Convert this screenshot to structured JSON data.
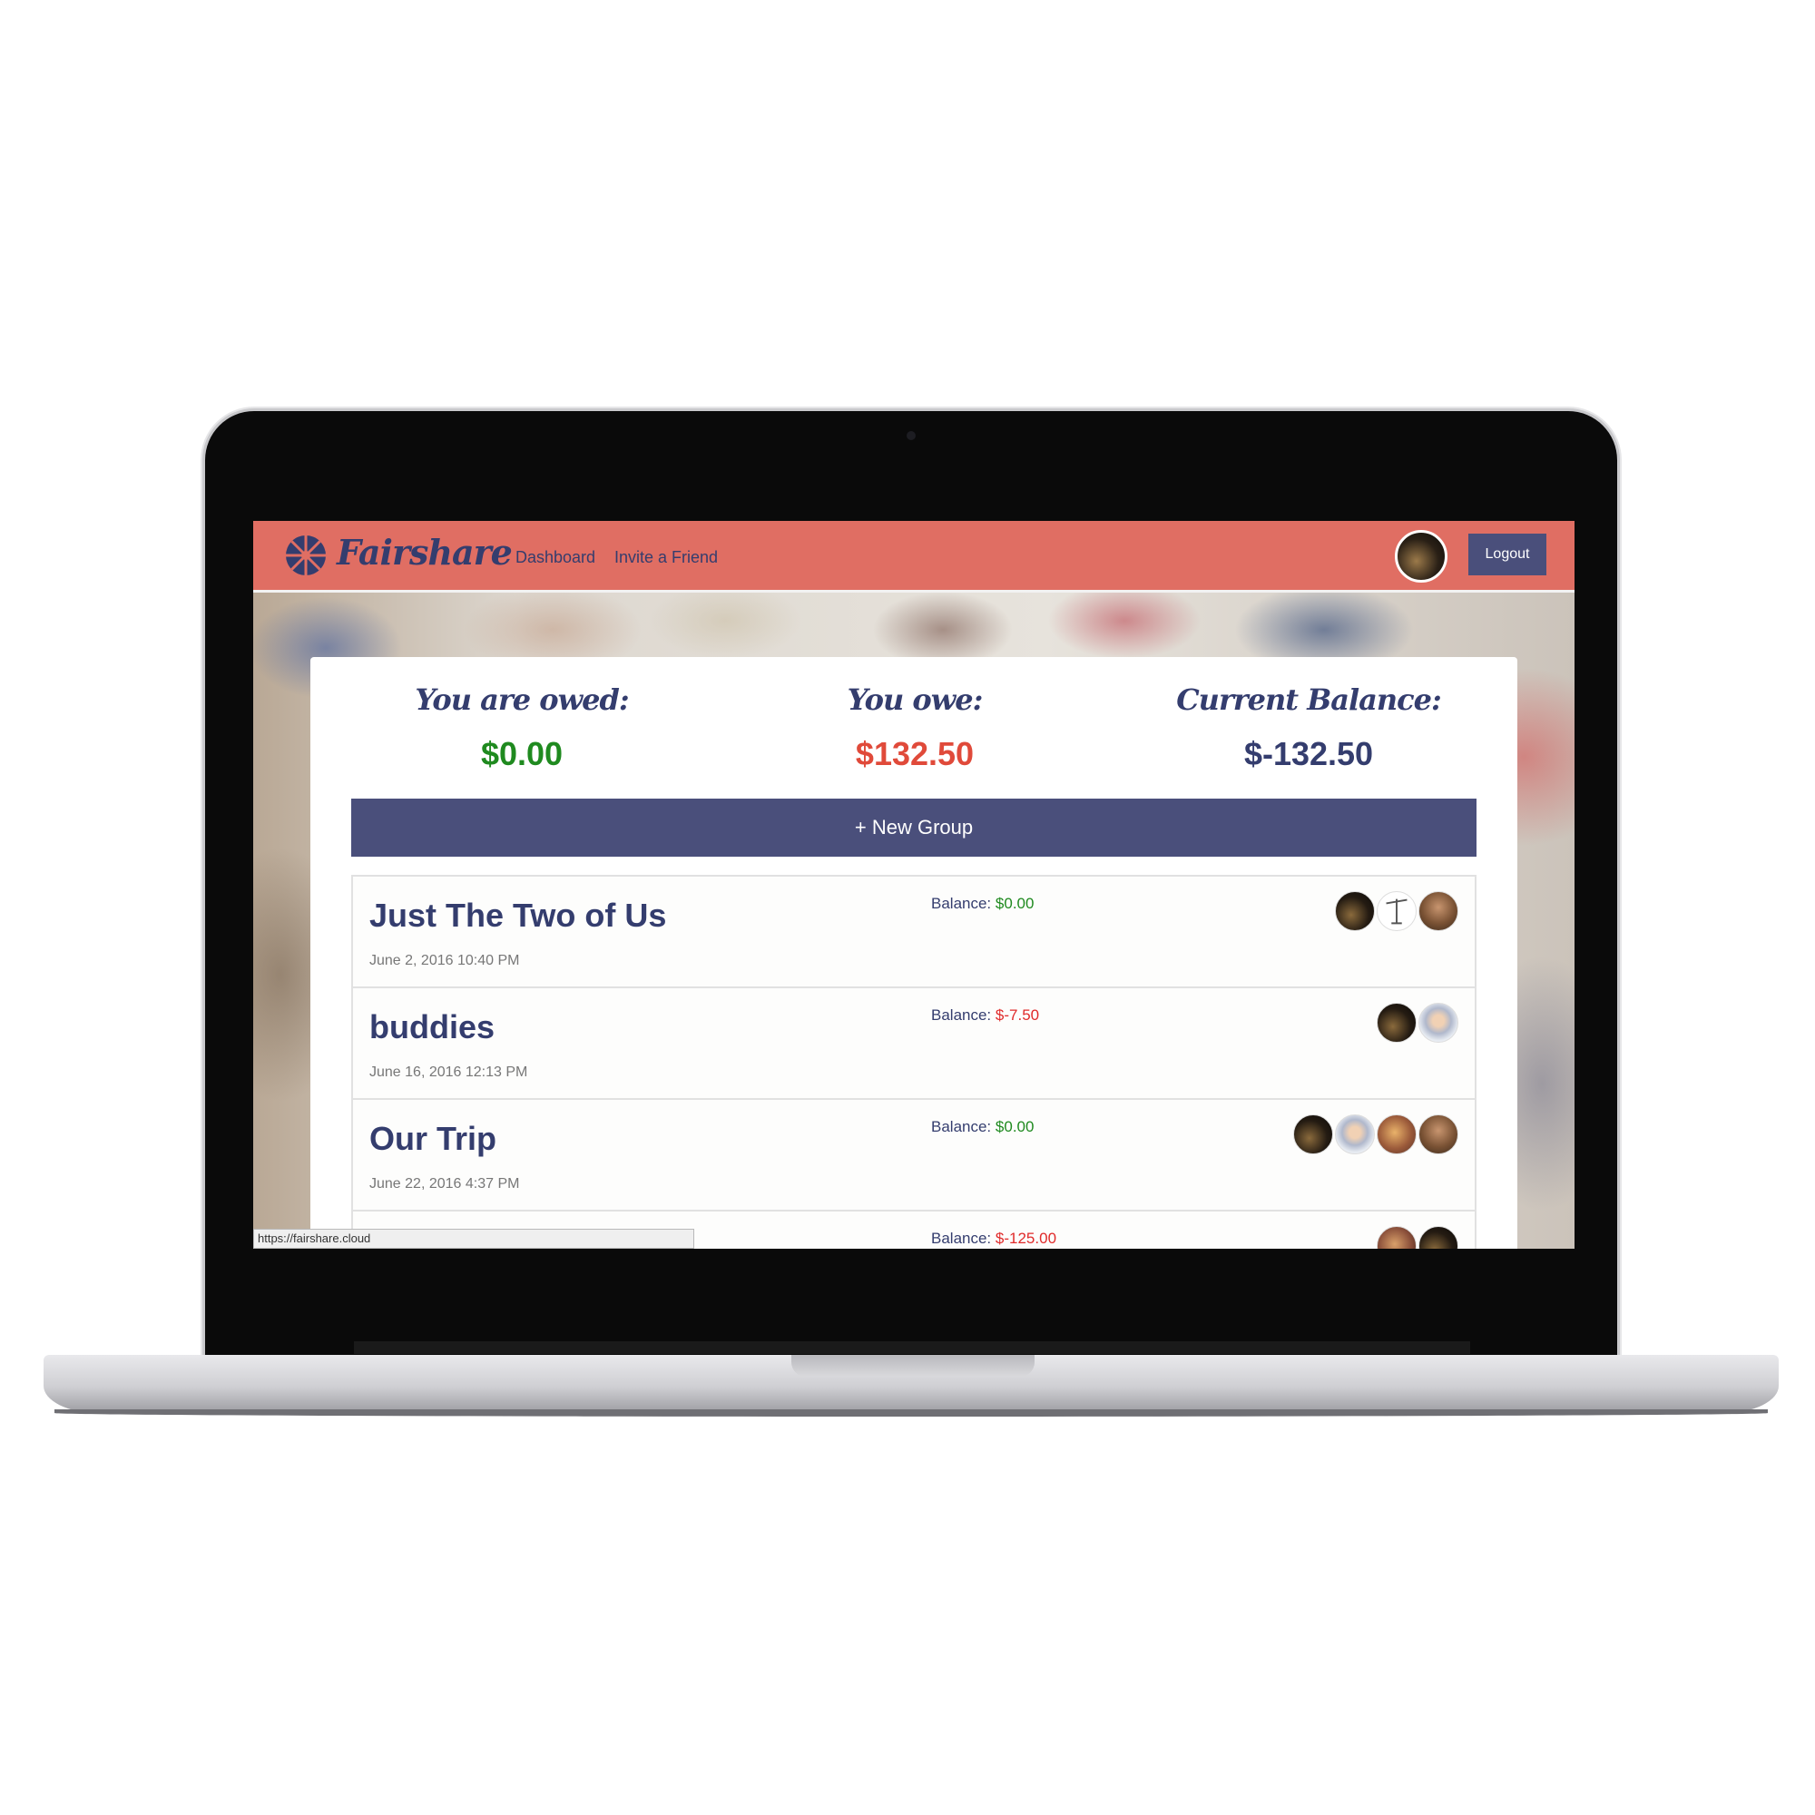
{
  "app": {
    "brand": "Fairshare"
  },
  "nav": {
    "links": [
      "Dashboard",
      "Invite a Friend"
    ],
    "logout_label": "Logout"
  },
  "summary": {
    "owed_label": "You are owed:",
    "owed_value": "$0.00",
    "owe_label": "You owe:",
    "owe_value": "$132.50",
    "balance_label": "Current Balance:",
    "balance_value": "$-132.50"
  },
  "actions": {
    "new_group_label": "+ New Group"
  },
  "groups": [
    {
      "name": "Just The Two of Us",
      "date": "June 2, 2016 10:40 PM",
      "balance_label": "Balance:",
      "balance": "$0.00",
      "members": [
        "dark-photo-avatar",
        "scale-avatar",
        "man-avatar"
      ]
    },
    {
      "name": "buddies",
      "date": "June 16, 2016 12:13 PM",
      "balance_label": "Balance:",
      "balance": "$-7.50",
      "members": [
        "dark-photo-avatar",
        "woman-avatar"
      ]
    },
    {
      "name": "Our Trip",
      "date": "June 22, 2016 4:37 PM",
      "balance_label": "Balance:",
      "balance": "$0.00",
      "members": [
        "dark-photo-avatar",
        "woman-avatar",
        "food-avatar",
        "man-avatar"
      ]
    },
    {
      "name": "",
      "date": "",
      "balance_label": "Balance:",
      "balance": "$-125.00",
      "members": [
        "mixed-avatar",
        "dark-photo-avatar"
      ]
    }
  ],
  "status_bar": {
    "url": "https://fairshare.cloud"
  },
  "colors": {
    "navbar": "#e06e63",
    "primary": "#4a4f7b",
    "text_dark": "#343d6e",
    "positive": "#1f8a1f",
    "negative": "#e04a3a"
  }
}
